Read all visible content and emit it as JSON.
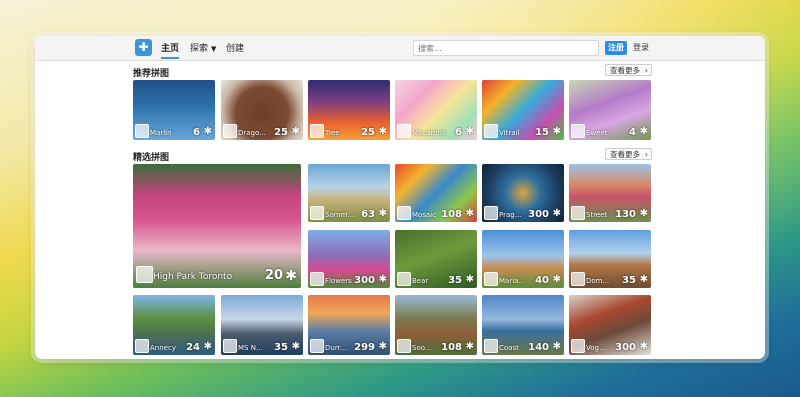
{
  "nav": {
    "logo_icon": "puzzle-logo-icon",
    "home": "主页",
    "explore": "探索",
    "create": "创建"
  },
  "search": {
    "placeholder": "搜索..."
  },
  "auth": {
    "register": "注册",
    "login": "登录"
  },
  "sections": {
    "featured": {
      "title": "推荐拼图",
      "more": "查看更多"
    },
    "selected": {
      "title": "精选拼图",
      "more": "查看更多"
    }
  },
  "featured": [
    {
      "title": "Marlin",
      "count": "6",
      "bg": "linear-gradient(180deg,#1f4f86 0%,#2e73ad 45%,#6aa8d8 100%)"
    },
    {
      "title": "Drago...",
      "count": "25",
      "bg": "radial-gradient(circle at 50% 55%,#6b3f2b 0%,#7d4b33 50%,#c9b8a8 75%,#e9e4dc 100%)"
    },
    {
      "title": "Tree",
      "count": "25",
      "bg": "linear-gradient(180deg,#2b2f6e 0%,#7c3c86 35%,#e8602e 70%,#f6a23b 100%)"
    },
    {
      "title": "Macarons",
      "count": "6",
      "bg": "linear-gradient(135deg,#f5d3e3 0%,#f4a6c8 30%,#f7e59a 55%,#9fe0b7 80%,#f7c6d8 100%)"
    },
    {
      "title": "Vitrail",
      "count": "15",
      "bg": "linear-gradient(135deg,#e2403a 0%,#f3b329 25%,#3aa9d8 50%,#c54fb0 75%,#58b84b 100%)"
    },
    {
      "title": "Sweet",
      "count": "4",
      "bg": "linear-gradient(160deg,#c9d7b4 0%,#b57bc9 40%,#d7a6e2 65%,#6f9a4f 100%)"
    }
  ],
  "selected": [
    {
      "title": "High Park Toronto",
      "count": "20",
      "bg": "linear-gradient(180deg,#3b6d3c 0%,#c2457e 25%,#d9568f 45%,#e8b9c8 70%,#4e7e3d 100%)"
    },
    {
      "title": "Somm...",
      "count": "63",
      "bg": "linear-gradient(180deg,#6aa6d8 0%,#b9d3e6 40%,#c9b27a 62%,#7d8f45 100%)"
    },
    {
      "title": "Mosaic",
      "count": "108",
      "bg": "linear-gradient(135deg,#e54a2a 0%,#f2b531 25%,#3a88c9 50%,#8ec64c 75%,#d3423d 100%)"
    },
    {
      "title": "Prag...",
      "count": "300",
      "bg": "radial-gradient(circle at 50% 50%,#d7a640 0%,#2f6e9e 35%,#1c3d5e 70%,#0f2438 100%)"
    },
    {
      "title": "Street",
      "count": "130",
      "bg": "linear-gradient(180deg,#9cc2e6 0%,#d98a6a 35%,#c9546a 55%,#6b8f4e 100%)"
    },
    {
      "title": "Flowers",
      "count": "300",
      "bg": "linear-gradient(180deg,#7eaee6 0%,#8f6bb8 45%,#d64a8a 70%,#4f8a3e 100%)"
    },
    {
      "title": "Bear",
      "count": "35",
      "bg": "linear-gradient(160deg,#446f2c 0%,#6e9a3d 45%,#2f5a24 100%)"
    },
    {
      "title": "Maria...",
      "count": "40",
      "bg": "linear-gradient(180deg,#4d8fd6 0%,#9cc5ea 45%,#c98b52 65%,#5d8e3a 100%)"
    },
    {
      "title": "Dom...",
      "count": "35",
      "bg": "linear-gradient(180deg,#5f9fe0 0%,#b3d1ef 40%,#b57848 60%,#6c4b33 100%)"
    },
    {
      "title": "Annecy",
      "count": "24",
      "bg": "linear-gradient(180deg,#7fb3e6 0%,#5c8f3f 40%,#4a6c5a 70%,#2f5e7f 100%)"
    },
    {
      "title": "MS N...",
      "count": "35",
      "bg": "linear-gradient(180deg,#7fa8d8 0%,#c8d8e8 40%,#4b5a6d 65%,#1f3f5f 100%)"
    },
    {
      "title": "Durr...",
      "count": "299",
      "bg": "linear-gradient(180deg,#e47a4a 0%,#f2a657 30%,#5d7fa8 60%,#2f5070 100%)"
    },
    {
      "title": "Soo...",
      "count": "108",
      "bg": "linear-gradient(180deg,#9bb9d9 0%,#7a7a4a 40%,#8f5e3a 65%,#4f6e3a 100%)"
    },
    {
      "title": "Coast",
      "count": "140",
      "bg": "linear-gradient(180deg,#4f86c8 0%,#95b9de 40%,#3b6e9e 60%,#6c7a4a 100%)"
    },
    {
      "title": "Vog...",
      "count": "300",
      "bg": "linear-gradient(160deg,#d8d2c8 0%,#a8482f 35%,#6c4a3a 60%,#e3e0da 100%)"
    }
  ]
}
